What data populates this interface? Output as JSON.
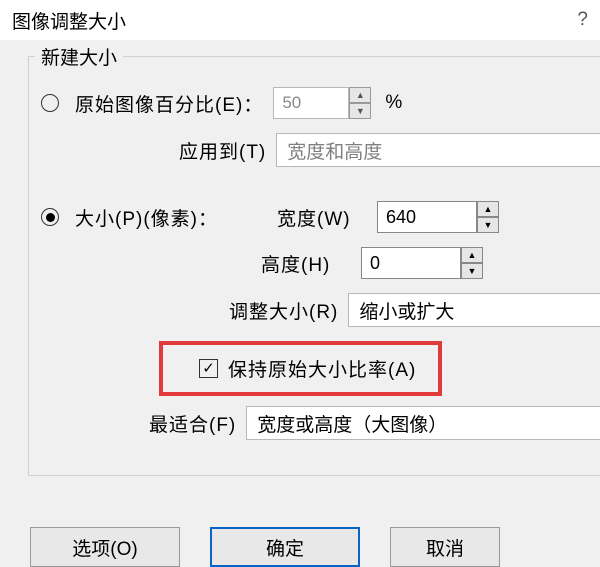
{
  "title": "图像调整大小",
  "help": "?",
  "legend": "新建大小",
  "percent": {
    "label": "原始图像百分比(E)：",
    "value": "50",
    "unit": "%"
  },
  "applyTo": {
    "label": "应用到(T)",
    "value": "宽度和高度"
  },
  "size": {
    "label": "大小(P)(像素)：",
    "width_label": "宽度(W)",
    "width_value": "640",
    "height_label": "高度(H)",
    "height_value": "0"
  },
  "resize": {
    "label": "调整大小(R)",
    "value": "缩小或扩大"
  },
  "keepRatio": {
    "label": "保持原始大小比率(A)"
  },
  "bestFit": {
    "label": "最适合(F)",
    "value": "宽度或高度（大图像）"
  },
  "buttons": {
    "options": "选项(O)",
    "ok": "确定",
    "cancel": "取消"
  }
}
